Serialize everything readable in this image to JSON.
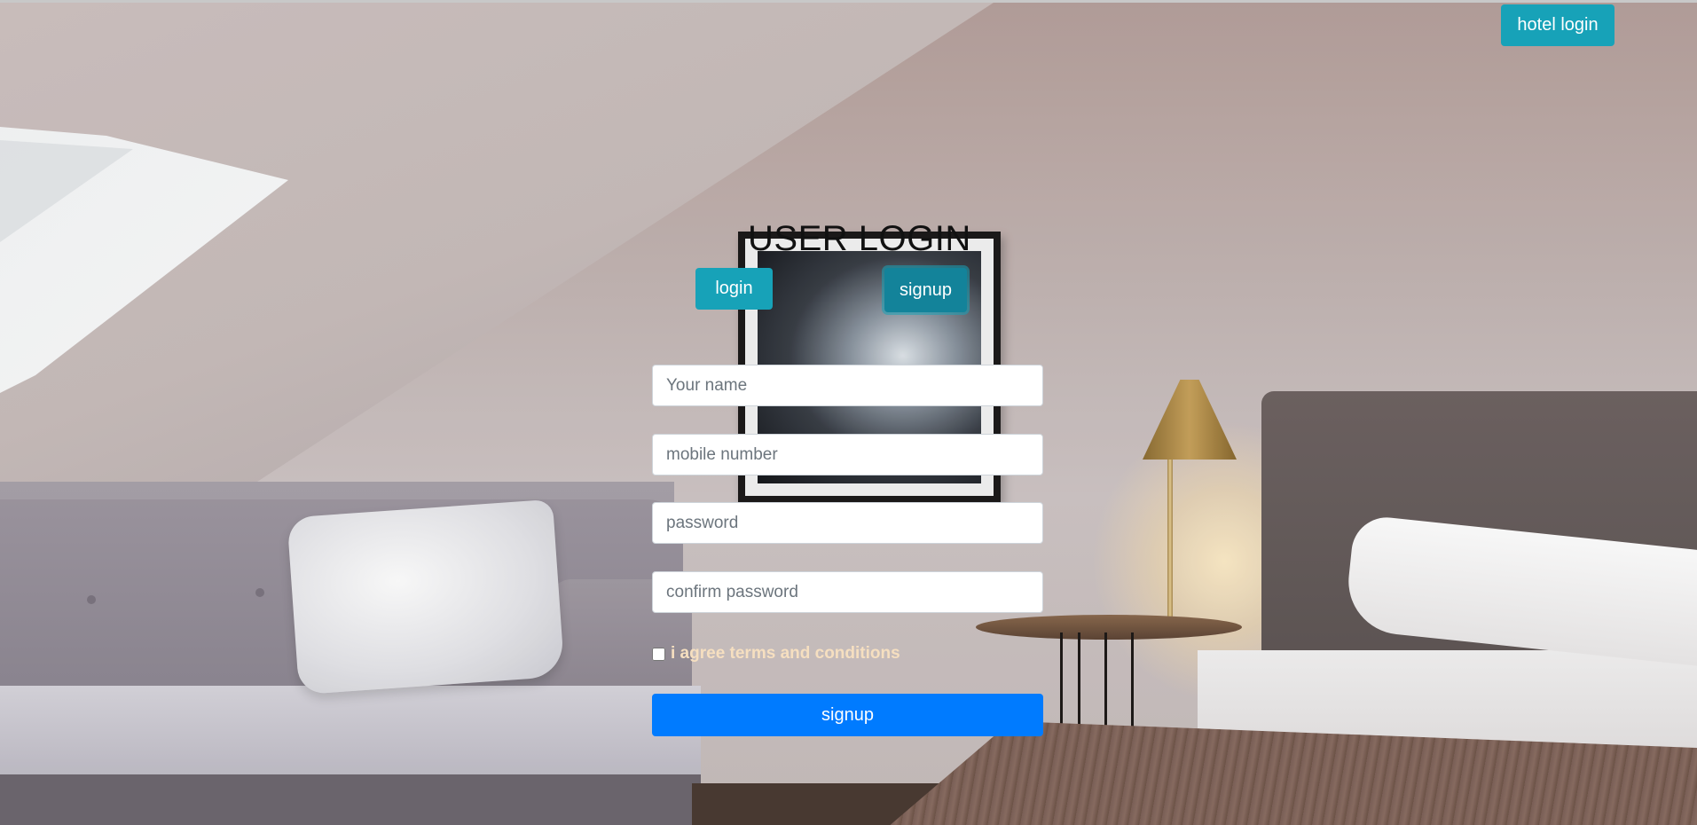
{
  "header": {
    "hotel_login_label": "hotel login"
  },
  "form": {
    "title": "USER LOGIN",
    "tabs": {
      "login_label": "login",
      "signup_label": "signup",
      "active": "signup"
    },
    "fields": {
      "name_placeholder": "Your name",
      "mobile_placeholder": "mobile number",
      "password_placeholder": "password",
      "confirm_placeholder": "confirm password"
    },
    "agree": {
      "label": "i agree terms and conditions",
      "checked": false
    },
    "submit_label": "signup"
  },
  "colors": {
    "info_button": "#17a2b8",
    "primary_button": "#007bff",
    "agree_text": "#f6dfc0"
  }
}
